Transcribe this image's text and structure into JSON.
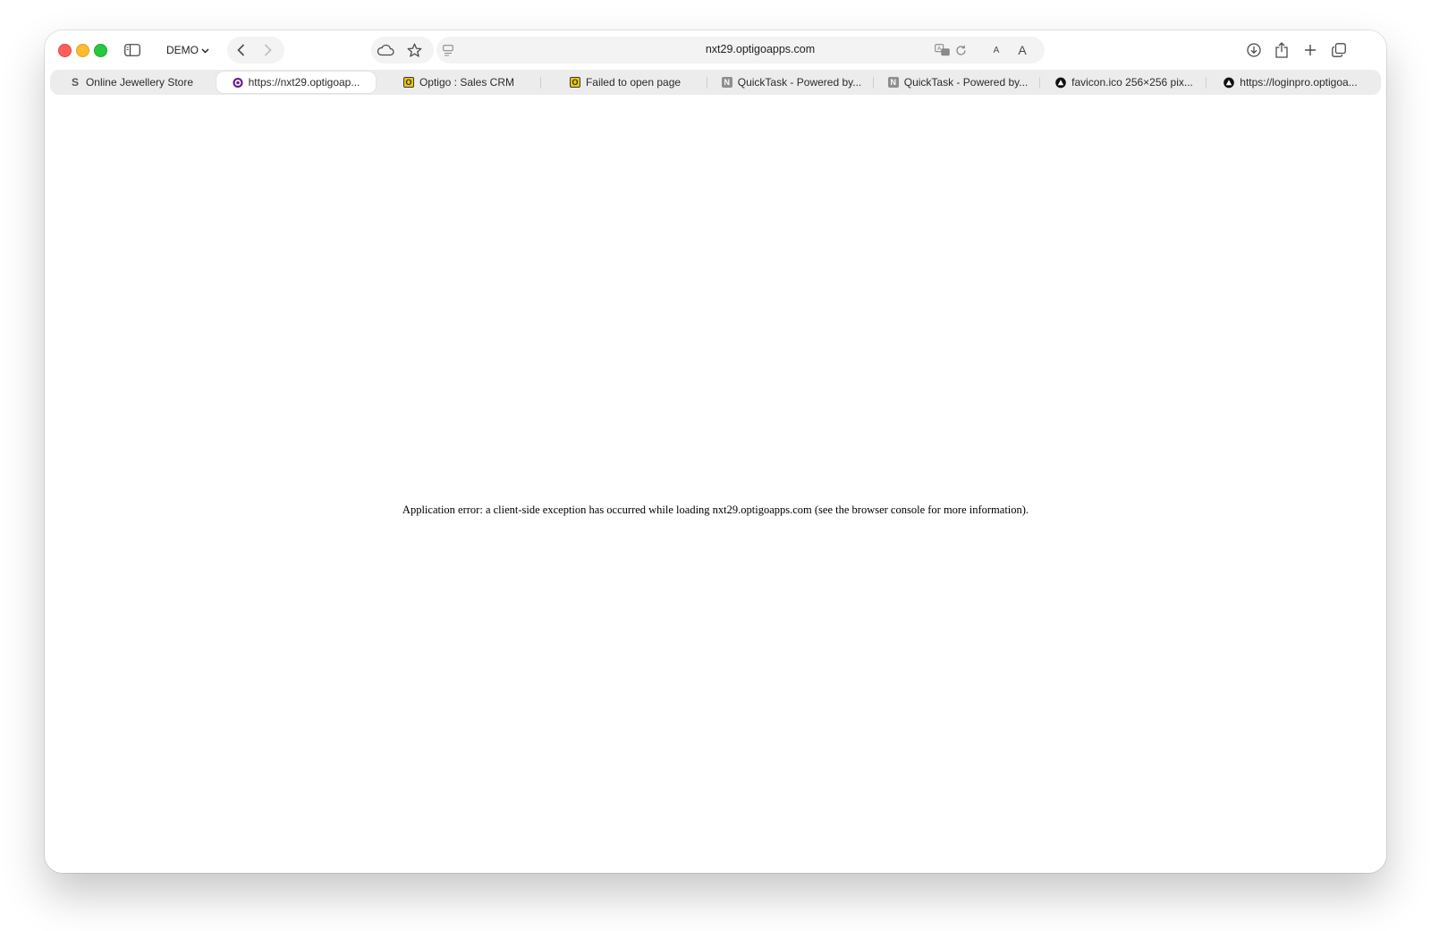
{
  "toolbar": {
    "profile_label": "DEMO",
    "url": "nxt29.optigoapps.com",
    "text_smaller_label": "A",
    "text_larger_label": "A"
  },
  "tabs": [
    {
      "title": "Online Jewellery Store",
      "favicon": "S",
      "active": false
    },
    {
      "title": "https://nxt29.optigoap...",
      "favicon": "O",
      "active": true
    },
    {
      "title": "Optigo : Sales CRM",
      "favicon": "O",
      "active": false
    },
    {
      "title": "Failed to open page",
      "favicon": "O",
      "active": false
    },
    {
      "title": "QuickTask - Powered by...",
      "favicon": "N",
      "active": false
    },
    {
      "title": "QuickTask - Powered by...",
      "favicon": "N",
      "active": false
    },
    {
      "title": "favicon.ico 256×256 pix...",
      "favicon": "triangle-icon",
      "active": false
    },
    {
      "title": "https://loginpro.optigoa...",
      "favicon": "triangle-icon",
      "active": false
    }
  ],
  "page": {
    "error_message": "Application error: a client-side exception has occurred while loading nxt29.optigoapps.com (see the browser console for more information)."
  },
  "colors": {
    "close": "#ff5f57",
    "minimize": "#febc2e",
    "maximize": "#28c840",
    "active_tab_favicon": "#6b1b8a",
    "optigo_favicon": "#e8c51a"
  }
}
